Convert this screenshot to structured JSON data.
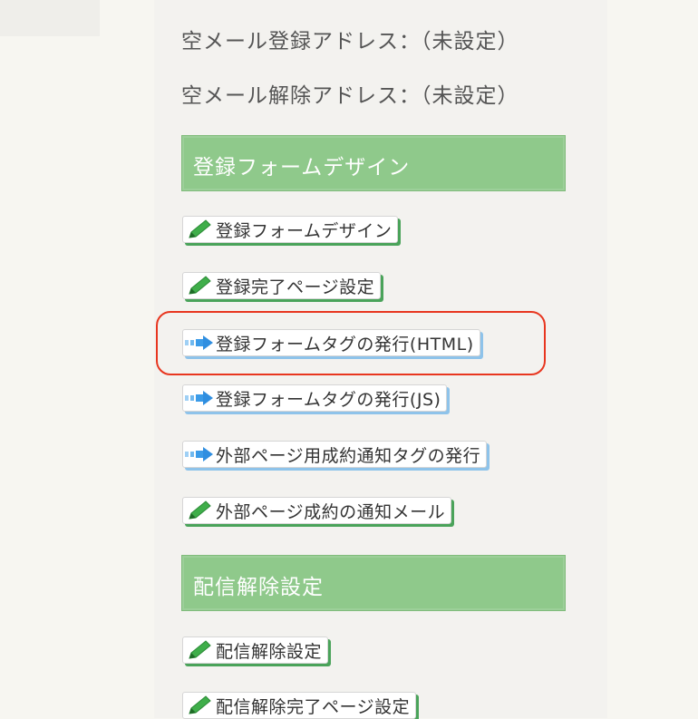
{
  "info": {
    "empty_mail_register": "空メール登録アドレス：（未設定）",
    "empty_mail_cancel": "空メール解除アドレス：（未設定）"
  },
  "sections": {
    "form_design": {
      "title": "登録フォームデザイン",
      "buttons": [
        {
          "label": "登録フォームデザイン",
          "icon": "pencil-icon"
        },
        {
          "label": "登録完了ページ設定",
          "icon": "pencil-icon"
        },
        {
          "label": "登録フォームタグの発行(HTML)",
          "icon": "arrow-right-icon"
        },
        {
          "label": "登録フォームタグの発行(JS)",
          "icon": "arrow-right-icon"
        },
        {
          "label": "外部ページ用成約通知タグの発行",
          "icon": "arrow-right-icon"
        },
        {
          "label": "外部ページ成約の通知メール",
          "icon": "pencil-icon"
        }
      ]
    },
    "unsubscribe": {
      "title": "配信解除設定",
      "buttons": [
        {
          "label": "配信解除設定",
          "icon": "pencil-icon"
        },
        {
          "label": "配信解除完了ページ設定",
          "icon": "pencil-icon"
        }
      ]
    }
  },
  "colors": {
    "section_header": "#8fc98b",
    "green_shadow": "#4aa35a",
    "blue_shadow": "#8ec3ea",
    "highlight": "#e8361f"
  }
}
